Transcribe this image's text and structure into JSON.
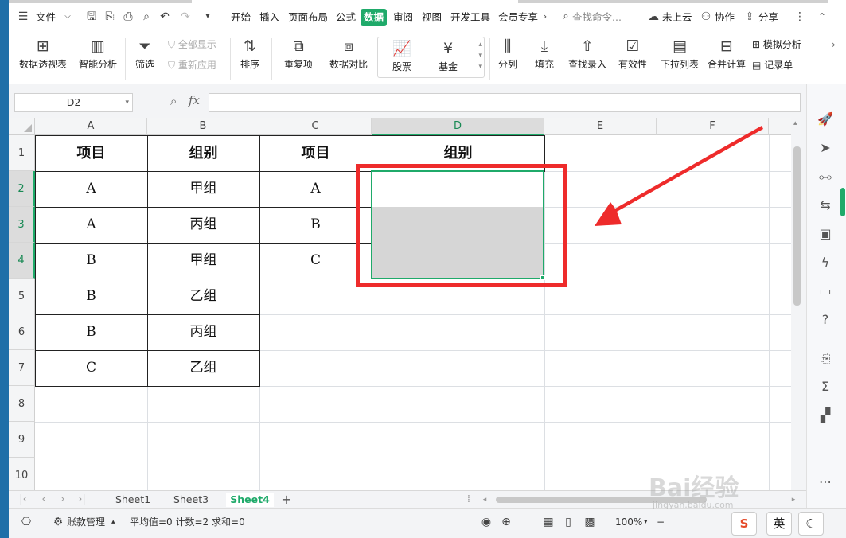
{
  "menubar": {
    "file_label": "文件",
    "tabs": [
      "开始",
      "插入",
      "页面布局",
      "公式",
      "数据",
      "审阅",
      "视图",
      "开发工具",
      "会员专享"
    ],
    "active_tab": "数据",
    "search_placeholder": "查找命令...",
    "cloud_label": "未上云",
    "collab_label": "协作",
    "share_label": "分享"
  },
  "ribbon": {
    "pivot": "数据透视表",
    "smart": "智能分析",
    "filter": "筛选",
    "show_all": "全部显示",
    "reapply": "重新应用",
    "sort": "排序",
    "duplicates": "重复项",
    "compare": "数据对比",
    "stock": "股票",
    "fund": "基金",
    "split": "分列",
    "fill": "填充",
    "lookup": "查找录入",
    "validity": "有效性",
    "dropdown": "下拉列表",
    "merge_calc": "合并计算",
    "simulate": "模拟分析",
    "record": "记录单"
  },
  "formula_bar": {
    "name_box": "D2",
    "fx": "fx",
    "content": ""
  },
  "grid": {
    "columns": [
      "A",
      "B",
      "C",
      "D",
      "E",
      "F"
    ],
    "selected_column": "D",
    "rows": [
      "1",
      "2",
      "3",
      "4",
      "5",
      "6",
      "7",
      "8",
      "9",
      "10"
    ],
    "selected_rows": [
      "2",
      "3",
      "4"
    ],
    "table1": {
      "headers": [
        "项目",
        "组别"
      ],
      "rows": [
        [
          "A",
          "甲组"
        ],
        [
          "A",
          "丙组"
        ],
        [
          "B",
          "甲组"
        ],
        [
          "B",
          "乙组"
        ],
        [
          "B",
          "丙组"
        ],
        [
          "C",
          "乙组"
        ]
      ]
    },
    "table2": {
      "headers": [
        "项目",
        "组别"
      ],
      "rows": [
        [
          "A",
          ""
        ],
        [
          "B",
          ""
        ],
        [
          "C",
          ""
        ]
      ]
    }
  },
  "sheet_tabs": [
    "Sheet1",
    "Sheet3",
    "Sheet4"
  ],
  "active_sheet": "Sheet4",
  "statusbar": {
    "account": "账款管理",
    "stats": "平均值=0  计数=2  求和=0",
    "zoom": "100%",
    "ime_label": "英"
  },
  "watermark": {
    "brand": "Bai经验",
    "url": "jingyan.baidu.com"
  },
  "colors": {
    "accent": "#1faa6a",
    "annotation": "#ee2b2b"
  }
}
